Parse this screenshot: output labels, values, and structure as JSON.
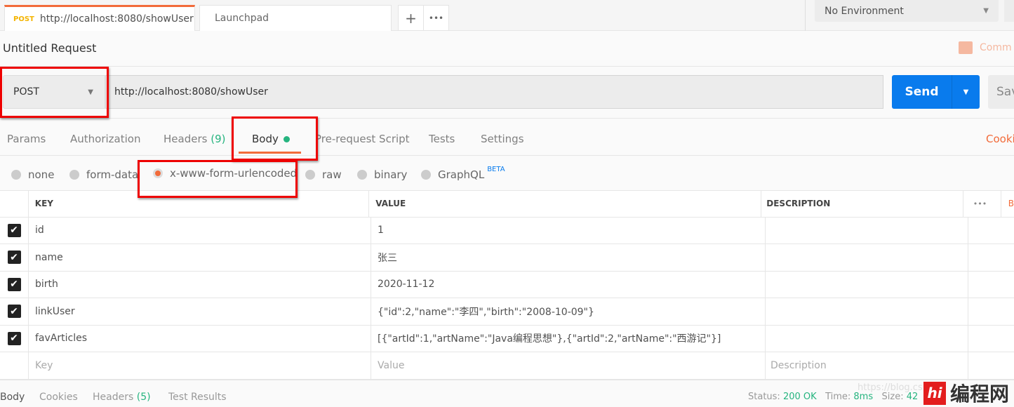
{
  "tabs": [
    {
      "method": "POST",
      "label": "http://localhost:8080/showUser",
      "unsaved": true
    },
    {
      "label": "Launchpad"
    }
  ],
  "tab_actions": {
    "add": "+",
    "more": "•••"
  },
  "environment": "No Environment",
  "request_title": "Untitled Request",
  "comments_label": "Comm",
  "method": "POST",
  "url": "http://localhost:8080/showUser",
  "send_label": "Send",
  "save_label": "Sav",
  "request_tabs": [
    {
      "label": "Params"
    },
    {
      "label": "Authorization"
    },
    {
      "label": "Headers",
      "count": "(9)"
    },
    {
      "label": "Body",
      "active": true
    },
    {
      "label": "Pre-request Script"
    },
    {
      "label": "Tests"
    },
    {
      "label": "Settings"
    }
  ],
  "cookies_label": "Cooki",
  "body_modes": [
    {
      "label": "none"
    },
    {
      "label": "form-data"
    },
    {
      "label": "x-www-form-urlencoded",
      "selected": true
    },
    {
      "label": "raw"
    },
    {
      "label": "binary"
    },
    {
      "label": "GraphQL",
      "badge": "BETA"
    }
  ],
  "table": {
    "headers": {
      "key": "KEY",
      "value": "VALUE",
      "description": "DESCRIPTION",
      "more": "•••",
      "bulk": "B"
    },
    "rows": [
      {
        "checked": true,
        "key": "id",
        "value": "1",
        "description": ""
      },
      {
        "checked": true,
        "key": "name",
        "value": "张三",
        "description": ""
      },
      {
        "checked": true,
        "key": "birth",
        "value": "2020-11-12",
        "description": ""
      },
      {
        "checked": true,
        "key": "linkUser",
        "value": "{\"id\":2,\"name\":\"李四\",\"birth\":\"2008-10-09\"}",
        "description": ""
      },
      {
        "checked": true,
        "key": "favArticles",
        "value": "[{\"artId\":1,\"artName\":\"Java编程思想\"},{\"artId\":2,\"artName\":\"西游记\"}]",
        "description": ""
      }
    ],
    "placeholders": {
      "key": "Key",
      "value": "Value",
      "description": "Description"
    }
  },
  "response_tabs": [
    {
      "label": "Body"
    },
    {
      "label": "Cookies"
    },
    {
      "label": "Headers",
      "count": "(5)"
    },
    {
      "label": "Test Results"
    }
  ],
  "response_status": {
    "status_label": "Status:",
    "status": "200 OK",
    "time_label": "Time:",
    "time": "8ms",
    "size_label": "Size:",
    "size": "42"
  },
  "watermark": {
    "url": "https://blog.cs",
    "logo_badge": "hi",
    "logo_text": "编程网"
  },
  "colors": {
    "accent": "#f26b3a",
    "send": "#097bed",
    "success": "#26b47f",
    "annotation": "#e00000"
  }
}
